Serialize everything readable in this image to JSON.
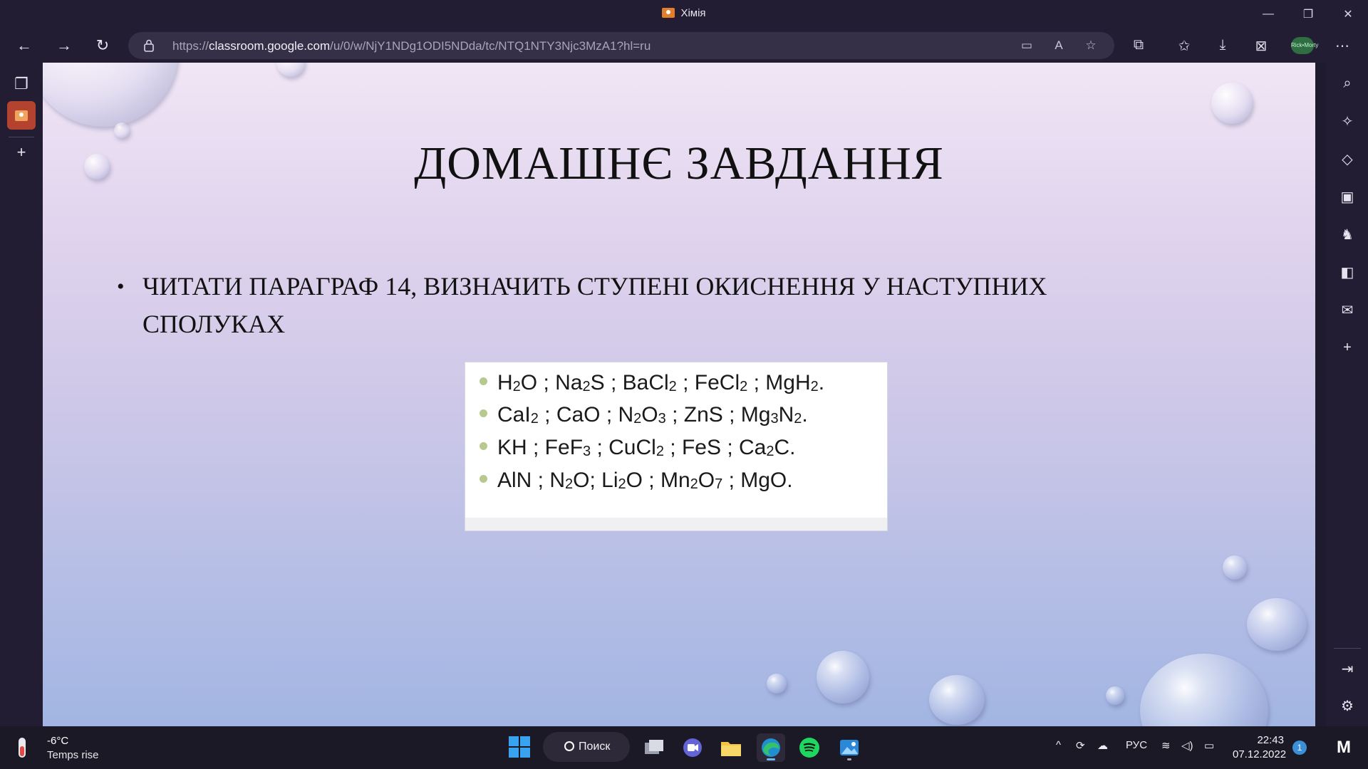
{
  "window": {
    "title": "Хімія",
    "controls": {
      "minimize": "—",
      "restore": "❐",
      "close": "✕"
    }
  },
  "browser": {
    "url_prefix": "https://",
    "url_domain": "classroom.google.com",
    "url_path": "/u/0/w/NjY1NDg1ODI5NDda/tc/NTQ1NTY3Njc3MzA1?hl=ru",
    "nav": {
      "back": "←",
      "forward": "→",
      "reload": "↻"
    },
    "url_icons": [
      "media-blocked-icon",
      "read-aloud-icon",
      "add-favorite-icon"
    ],
    "toolbar": [
      "extensions-icon",
      "favorites-icon",
      "downloads-icon",
      "web-capture-icon",
      "profile-avatar",
      "more-menu-icon"
    ],
    "profile_text": "Rick•Morty"
  },
  "left_sidebar": {
    "items": [
      {
        "name": "tab-actions-icon",
        "glyph": "❐"
      },
      {
        "name": "tab-classroom",
        "glyph": ""
      },
      {
        "name": "new-tab-icon",
        "glyph": "+"
      }
    ]
  },
  "right_sidebar": {
    "items": [
      {
        "name": "search-icon",
        "glyph": "⌕"
      },
      {
        "name": "discover-icon",
        "glyph": "✧"
      },
      {
        "name": "shopping-tag-icon",
        "glyph": "◇"
      },
      {
        "name": "tools-briefcase-icon",
        "glyph": "▣"
      },
      {
        "name": "games-icon",
        "glyph": "♞"
      },
      {
        "name": "office-icon",
        "glyph": "◧"
      },
      {
        "name": "outlook-icon",
        "glyph": "✉"
      },
      {
        "name": "add-icon",
        "glyph": "+"
      }
    ],
    "bottom": [
      {
        "name": "hide-sidebar-icon",
        "glyph": "⇥"
      },
      {
        "name": "settings-gear-icon",
        "glyph": "⚙"
      }
    ]
  },
  "slide": {
    "title": "ДОМАШНЄ ЗАВДАННЯ",
    "bullet_mark": "•",
    "bullet_line1": "ЧИТАТИ ПАРАГРАФ 14, ВИЗНАЧИТЬ СТУПЕНІ ОКИСНЕННЯ У НАСТУПНИХ",
    "bullet_line2": "СПОЛУКАХ",
    "formulas": [
      "H2O ;  Na2S ;   BaCl2 ;   FeCl2 ; MgH2.",
      "CaI2 ;   CaO ;  N2O3 ;   ZnS ; Mg3N2.",
      "KH ;  FeF3 ; CuCl2 ;  FeS ;  Ca2C.",
      "AlN ; N2O;  Li2O ;  Mn2O7 ;  MgO."
    ]
  },
  "taskbar": {
    "weather_temp": "-6°C",
    "weather_desc": "Temps rise",
    "search_label": "Поиск",
    "apps": [
      "task-view-icon",
      "teams-chat-icon",
      "file-explorer-icon",
      "edge-browser-icon",
      "spotify-icon",
      "photos-icon"
    ],
    "tray_language": "РУС",
    "tray_chevron": "^",
    "clock_time": "22:43",
    "clock_date": "07.12.2022",
    "notification_count": "1",
    "corner_logo": "M"
  },
  "colors": {
    "chrome_bg": "#221d33",
    "taskbar_bg": "#1c1926",
    "slide_top": "#f0e6f5",
    "slide_bottom": "#a2b5e2",
    "classroom_accent": "#e37e2b"
  }
}
